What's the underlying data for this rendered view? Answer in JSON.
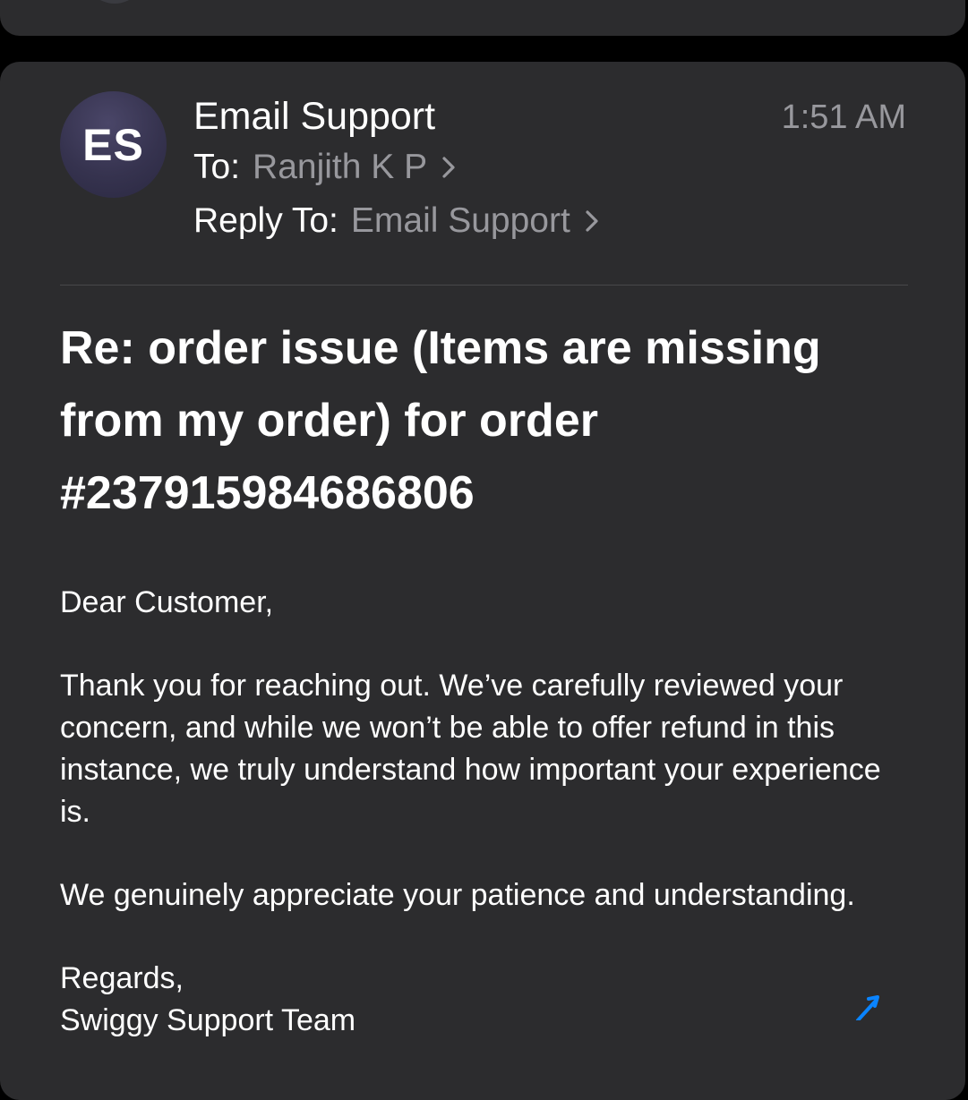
{
  "email": {
    "sender": {
      "initials": "ES",
      "name": "Email Support"
    },
    "time": "1:51 AM",
    "to": {
      "label": "To:",
      "value": "Ranjith K P"
    },
    "reply_to": {
      "label": "Reply To:",
      "value": "Email Support"
    },
    "subject": "Re: order issue (Items are missing from my order) for order #237915984686806",
    "body": {
      "greeting": "Dear Customer,",
      "paragraphs": [
        "Thank you for reaching out. We’ve carefully reviewed your concern, and while we won’t be able to offer refund in this instance, we truly understand how important your experience is.",
        "We genuinely appreciate your patience and understanding."
      ],
      "closing": "Regards,",
      "signature": "Swiggy Support Team"
    }
  },
  "icons": {
    "chevron": "chevron-right-icon",
    "send": "send-arrow-icon"
  },
  "colors": {
    "card_background": "#2c2c2e",
    "page_background": "#000000",
    "secondary_text": "#98989d",
    "primary_text": "#ffffff",
    "accent": "#0a84ff"
  }
}
